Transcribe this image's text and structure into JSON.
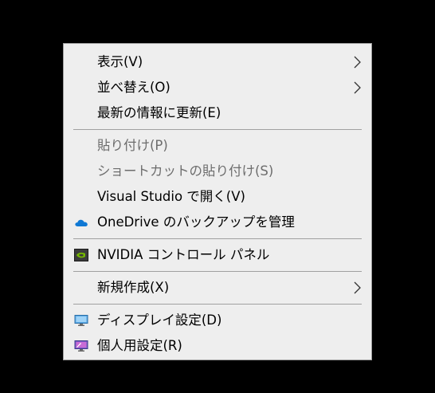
{
  "menu": {
    "items": [
      {
        "label": "表示(V)"
      },
      {
        "label": "並べ替え(O)"
      },
      {
        "label": "最新の情報に更新(E)"
      },
      {
        "label": "貼り付け(P)"
      },
      {
        "label": "ショートカットの貼り付け(S)"
      },
      {
        "label": "Visual Studio で開く(V)"
      },
      {
        "label": "OneDrive のバックアップを管理"
      },
      {
        "label": "NVIDIA コントロール パネル"
      },
      {
        "label": "新規作成(X)"
      },
      {
        "label": "ディスプレイ設定(D)"
      },
      {
        "label": "個人用設定(R)"
      }
    ]
  },
  "colors": {
    "menu_bg": "#eeeeee",
    "text": "#000000",
    "disabled_text": "#6d6d6d",
    "separator": "#a0a0a0",
    "onedrive": "#0f78d4",
    "nvidia_green": "#76b900"
  }
}
